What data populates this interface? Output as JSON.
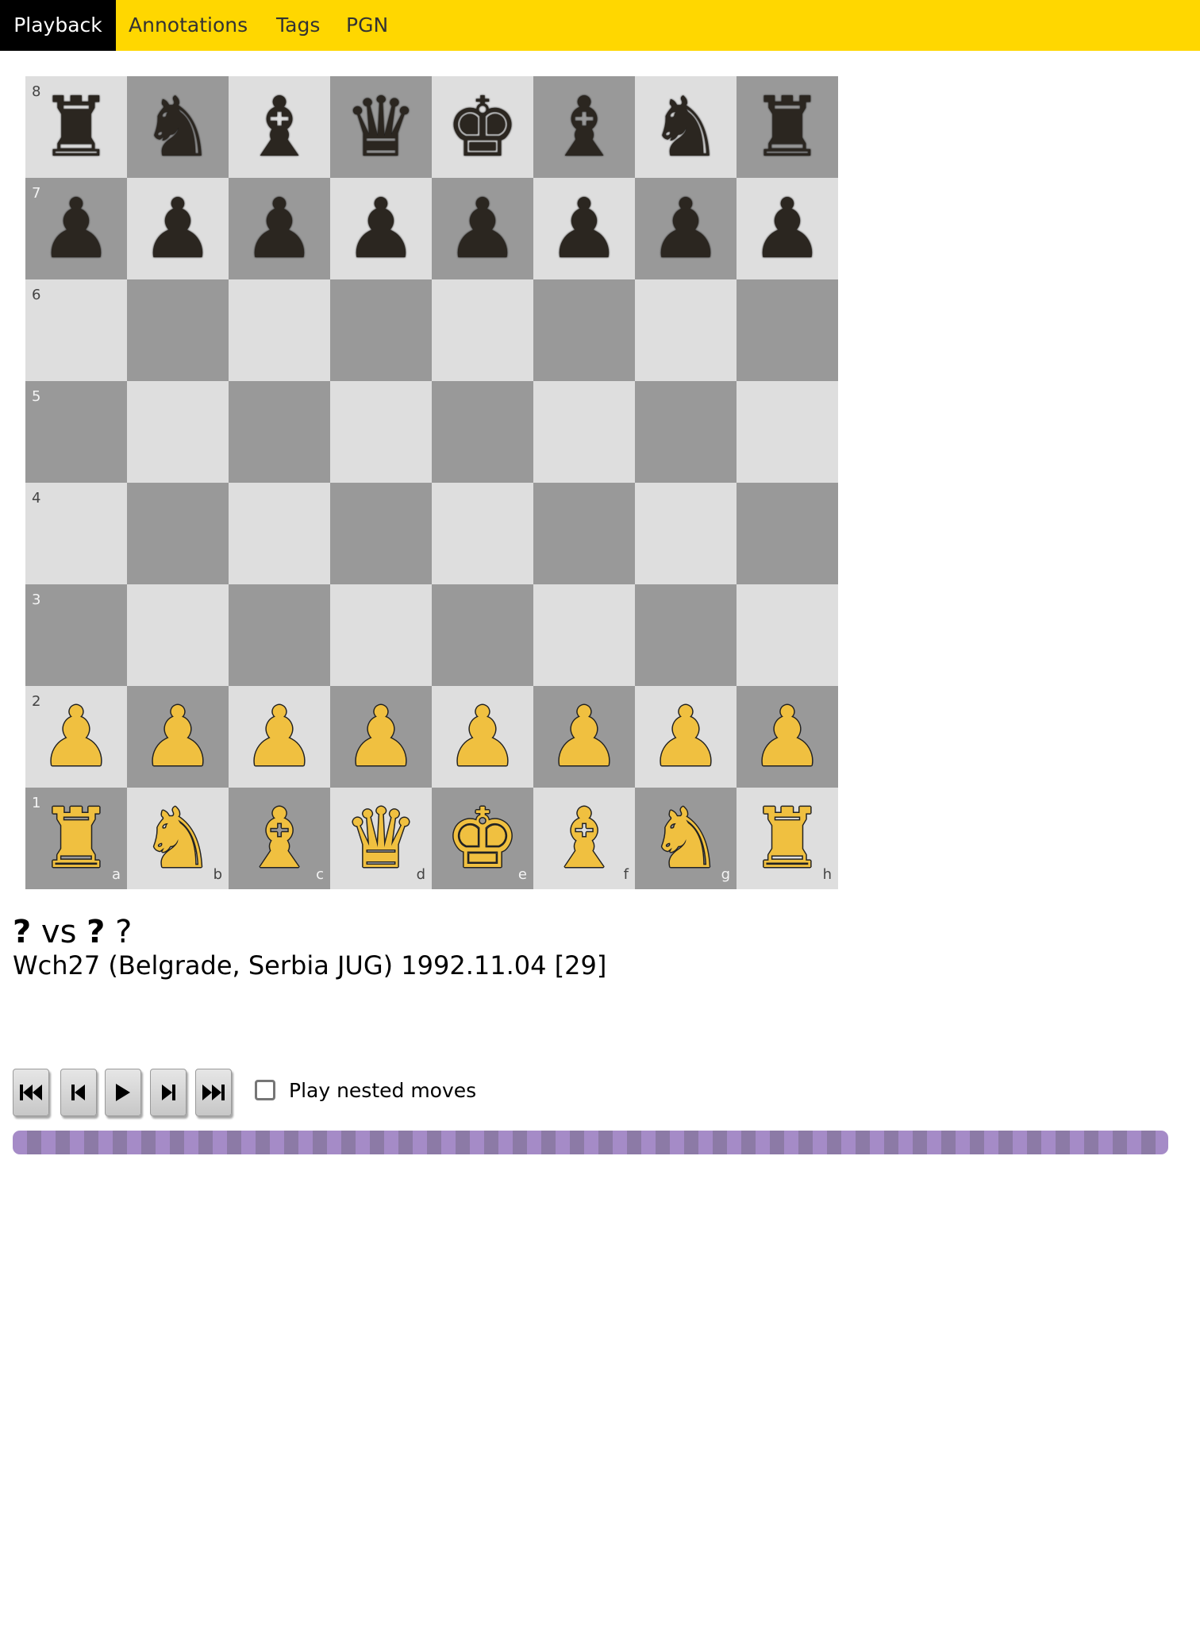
{
  "tabs": [
    {
      "label": "Playback",
      "active": true
    },
    {
      "label": "Annotations",
      "active": false
    },
    {
      "label": "Tags",
      "active": false
    },
    {
      "label": "PGN",
      "active": false
    }
  ],
  "board": {
    "ranks": [
      "8",
      "7",
      "6",
      "5",
      "4",
      "3",
      "2",
      "1"
    ],
    "files": [
      "a",
      "b",
      "c",
      "d",
      "e",
      "f",
      "g",
      "h"
    ],
    "rows": [
      [
        "r",
        "n",
        "b",
        "q",
        "k",
        "b",
        "n",
        "r"
      ],
      [
        "p",
        "p",
        "p",
        "p",
        "p",
        "p",
        "p",
        "p"
      ],
      [
        "",
        "",
        "",
        "",
        "",
        "",
        "",
        ""
      ],
      [
        "",
        "",
        "",
        "",
        "",
        "",
        "",
        ""
      ],
      [
        "",
        "",
        "",
        "",
        "",
        "",
        "",
        ""
      ],
      [
        "",
        "",
        "",
        "",
        "",
        "",
        "",
        ""
      ],
      [
        "P",
        "P",
        "P",
        "P",
        "P",
        "P",
        "P",
        "P"
      ],
      [
        "R",
        "N",
        "B",
        "Q",
        "K",
        "B",
        "N",
        "R"
      ]
    ],
    "colors": {
      "light": "#dedede",
      "dark": "#999999",
      "white_piece": "#f0c040",
      "black_piece": "#2b2620"
    }
  },
  "game": {
    "white": "?",
    "vs": "vs",
    "black": "?",
    "result": "?",
    "event_line": "Wch27 (Belgrade, Serbia JUG) 1992.11.04 [29]"
  },
  "controls": {
    "buttons": [
      "first-move",
      "previous-move",
      "play",
      "next-move",
      "last-move"
    ],
    "nested_label": "Play nested moves",
    "nested_checked": false,
    "progress_fraction": 1.0,
    "progress_colors": [
      "#a58bc7",
      "#8c7aa6"
    ]
  }
}
